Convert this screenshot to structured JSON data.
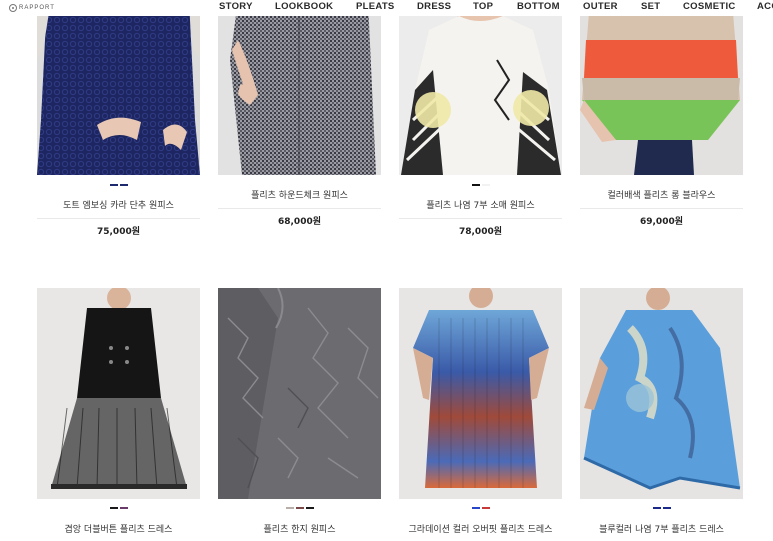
{
  "header": {
    "logo_text": "RAPPORT",
    "nav": [
      "STORY",
      "LOOKBOOK",
      "PLEATS",
      "DRESS",
      "TOP",
      "BOTTOM",
      "OUTER",
      "SET",
      "COSMETIC",
      "ACC"
    ]
  },
  "products": [
    {
      "name": "도트 엠보싱 카라 단추 원피스",
      "price": "75,000원",
      "swatches": [
        "#1e2a6e",
        "#1e2a6e"
      ],
      "image_icon": "navy-dot-dress-photo"
    },
    {
      "name": "플리츠 하운드체크 원피스",
      "price": "68,000원",
      "swatches": [],
      "image_icon": "houndstooth-dress-photo"
    },
    {
      "name": "플리츠 나염 7부 소매 원피스",
      "price": "78,000원",
      "swatches": [
        "#111111",
        "#f2f2f2"
      ],
      "image_icon": "printed-sleeve-dress-photo"
    },
    {
      "name": "컬러배색 플리츠 롱 블라우스",
      "price": "69,000원",
      "swatches": [],
      "image_icon": "colorblock-blouse-photo"
    },
    {
      "name": "겹앙 더블버튼 플리츠 드레스",
      "price": "",
      "swatches": [
        "#1a1a1a",
        "#6a3a6a"
      ],
      "image_icon": "double-button-dress-photo"
    },
    {
      "name": "플리츠 한지 원피스",
      "price": "",
      "swatches": [
        "#b8b0a8",
        "#7a4a4a",
        "#1a1a1a"
      ],
      "image_icon": "hanji-dress-photo"
    },
    {
      "name": "그라데이션 컬러 오버핏 플리츠 드레스",
      "price": "",
      "swatches": [
        "#2a46c8",
        "#c83a3a"
      ],
      "image_icon": "gradient-dress-photo"
    },
    {
      "name": "블루컬러 나염 7부 플리츠 드레스",
      "price": "",
      "swatches": [
        "#1a2a8a",
        "#1a2a8a"
      ],
      "image_icon": "blue-print-dress-photo"
    }
  ]
}
